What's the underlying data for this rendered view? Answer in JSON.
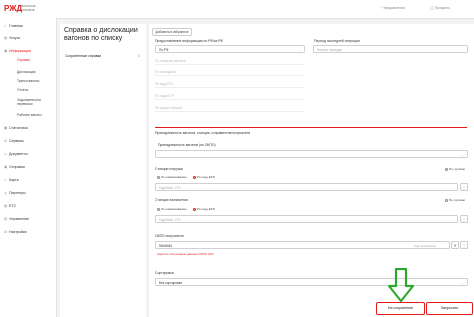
{
  "header": {
    "logo_text": "РЖД",
    "brand": "ОТКРЫТОЕ ГРУЗОВОЕ",
    "notifications": "Уведомления",
    "user": "Профиль"
  },
  "sidebar": {
    "items": [
      {
        "label": "Главная",
        "icon": "home-icon"
      },
      {
        "label": "Услуги",
        "icon": "services-icon"
      },
      {
        "label": "Информация",
        "icon": "info-icon"
      },
      {
        "label": "Статистика",
        "icon": "stats-icon"
      },
      {
        "label": "Сервисы",
        "icon": "tools-icon"
      },
      {
        "label": "Документы",
        "icon": "documents-icon"
      },
      {
        "label": "Отправки",
        "icon": "shipments-icon"
      },
      {
        "label": "Карта",
        "icon": "map-icon"
      },
      {
        "label": "Партнеры",
        "icon": "partners-icon"
      },
      {
        "label": "ЕТС",
        "icon": "ets-icon"
      },
      {
        "label": "Управление",
        "icon": "manage-icon"
      },
      {
        "label": "Настройки",
        "icon": "settings-icon"
      }
    ],
    "subitems": [
      "Справки",
      "Дислокация",
      "Трансп.вагоны",
      "Отчеты",
      "Задолженности перевозок",
      "Рабочие вагоны"
    ]
  },
  "left_panel": {
    "title": "Справка о дислокации вагонов по списку",
    "saved_label": "Сохранённые справки",
    "saved_count": "0"
  },
  "form": {
    "favorites_btn": "Добавить в избранное",
    "prov_label": "Предоставление информации по РФ/за РФ",
    "prov_value": "По РФ",
    "period_label": "Период последней операции",
    "period_placeholder": "Начало периода",
    "ghost1": "По номерам вагонов",
    "ghost2": "По накладной",
    "ghost3": "По коду ЕТС",
    "ghost4": "По коду ЕСР",
    "ghost5": "По кодам станций",
    "section_label": "Принадлежность вагонов, станции, отправителя/получателя",
    "okpo_own_label": "Принадлежность вагонов (по ОКПО)",
    "st_load_label": "Станции погрузки",
    "st_load_hint": "По группам",
    "r1a": "По наименованию",
    "r1b": "По коду ЕСР",
    "st_load_placeholder": "Код/Назв. СТН",
    "st_unload_label": "Станции назначения",
    "st_unload_hint": "По группам",
    "r2a": "По наименованию",
    "r2b": "По коду ЕСР",
    "st_unload_placeholder": "Код/Назв. СТН",
    "okpo_recv_label": "ОКПО получателя",
    "okpo_recv_value": "5t2e8061",
    "okpo_recv_link": "Удалить полученные данные ОКПО АСУ",
    "okpo_recv_chip": "Код получателя",
    "sort_label": "Сортировка",
    "sort_value": "Без сортировки",
    "btn_saved": "На сохранение",
    "btn_request": "Запросить"
  },
  "colors": {
    "brand_red": "#e21a1a",
    "arrow_green": "#2fa82f"
  }
}
